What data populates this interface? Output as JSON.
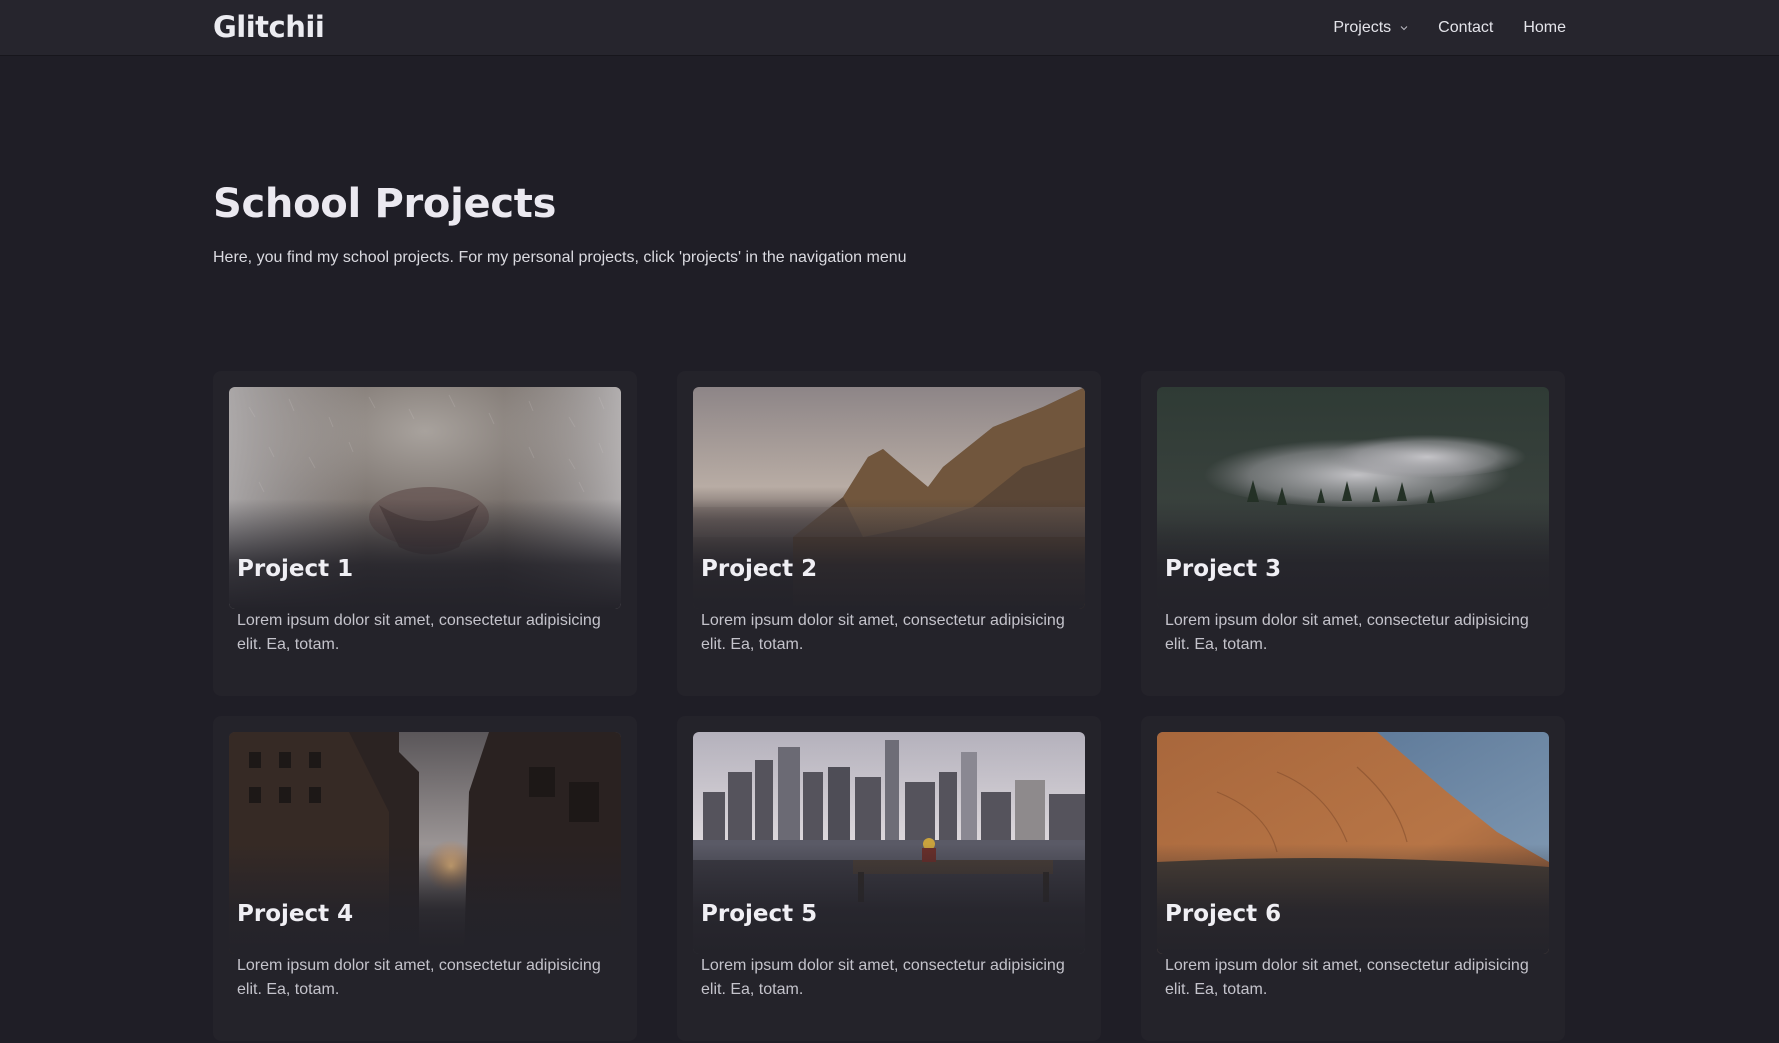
{
  "header": {
    "brand": "Glitchii",
    "nav": [
      {
        "label": "Projects",
        "has_dropdown": true,
        "icon": "chevron-down-icon"
      },
      {
        "label": "Contact"
      },
      {
        "label": "Home"
      }
    ]
  },
  "hero": {
    "title": "School Projects",
    "subtitle": "Here, you find my school projects. For my personal projects, click 'projects' in the navigation menu"
  },
  "projects": [
    {
      "title": "Project 1",
      "text": "Lorem ipsum dolor sit amet, consectetur adipisicing elit. Ea, totam.",
      "image": "fur-closeup-image"
    },
    {
      "title": "Project 2",
      "text": "Lorem ipsum dolor sit amet, consectetur adipisicing elit. Ea, totam.",
      "image": "coastal-mountain-image"
    },
    {
      "title": "Project 3",
      "text": "Lorem ipsum dolor sit amet, consectetur adipisicing elit. Ea, totam.",
      "image": "foggy-forest-image"
    },
    {
      "title": "Project 4",
      "text": "Lorem ipsum dolor sit amet, consectetur adipisicing elit. Ea, totam.",
      "image": "city-street-sunset-image"
    },
    {
      "title": "Project 5",
      "text": "Lorem ipsum dolor sit amet, consectetur adipisicing elit. Ea, totam.",
      "image": "city-skyline-image"
    },
    {
      "title": "Project 6",
      "text": "Lorem ipsum dolor sit amet, consectetur adipisicing elit. Ea, totam.",
      "image": "red-rock-image"
    }
  ],
  "colors": {
    "background": "#1f1e26",
    "navbar": "#26252d",
    "card": "#24232a",
    "text": "#e9e9ee",
    "muted_text": "#c4c3cb"
  }
}
